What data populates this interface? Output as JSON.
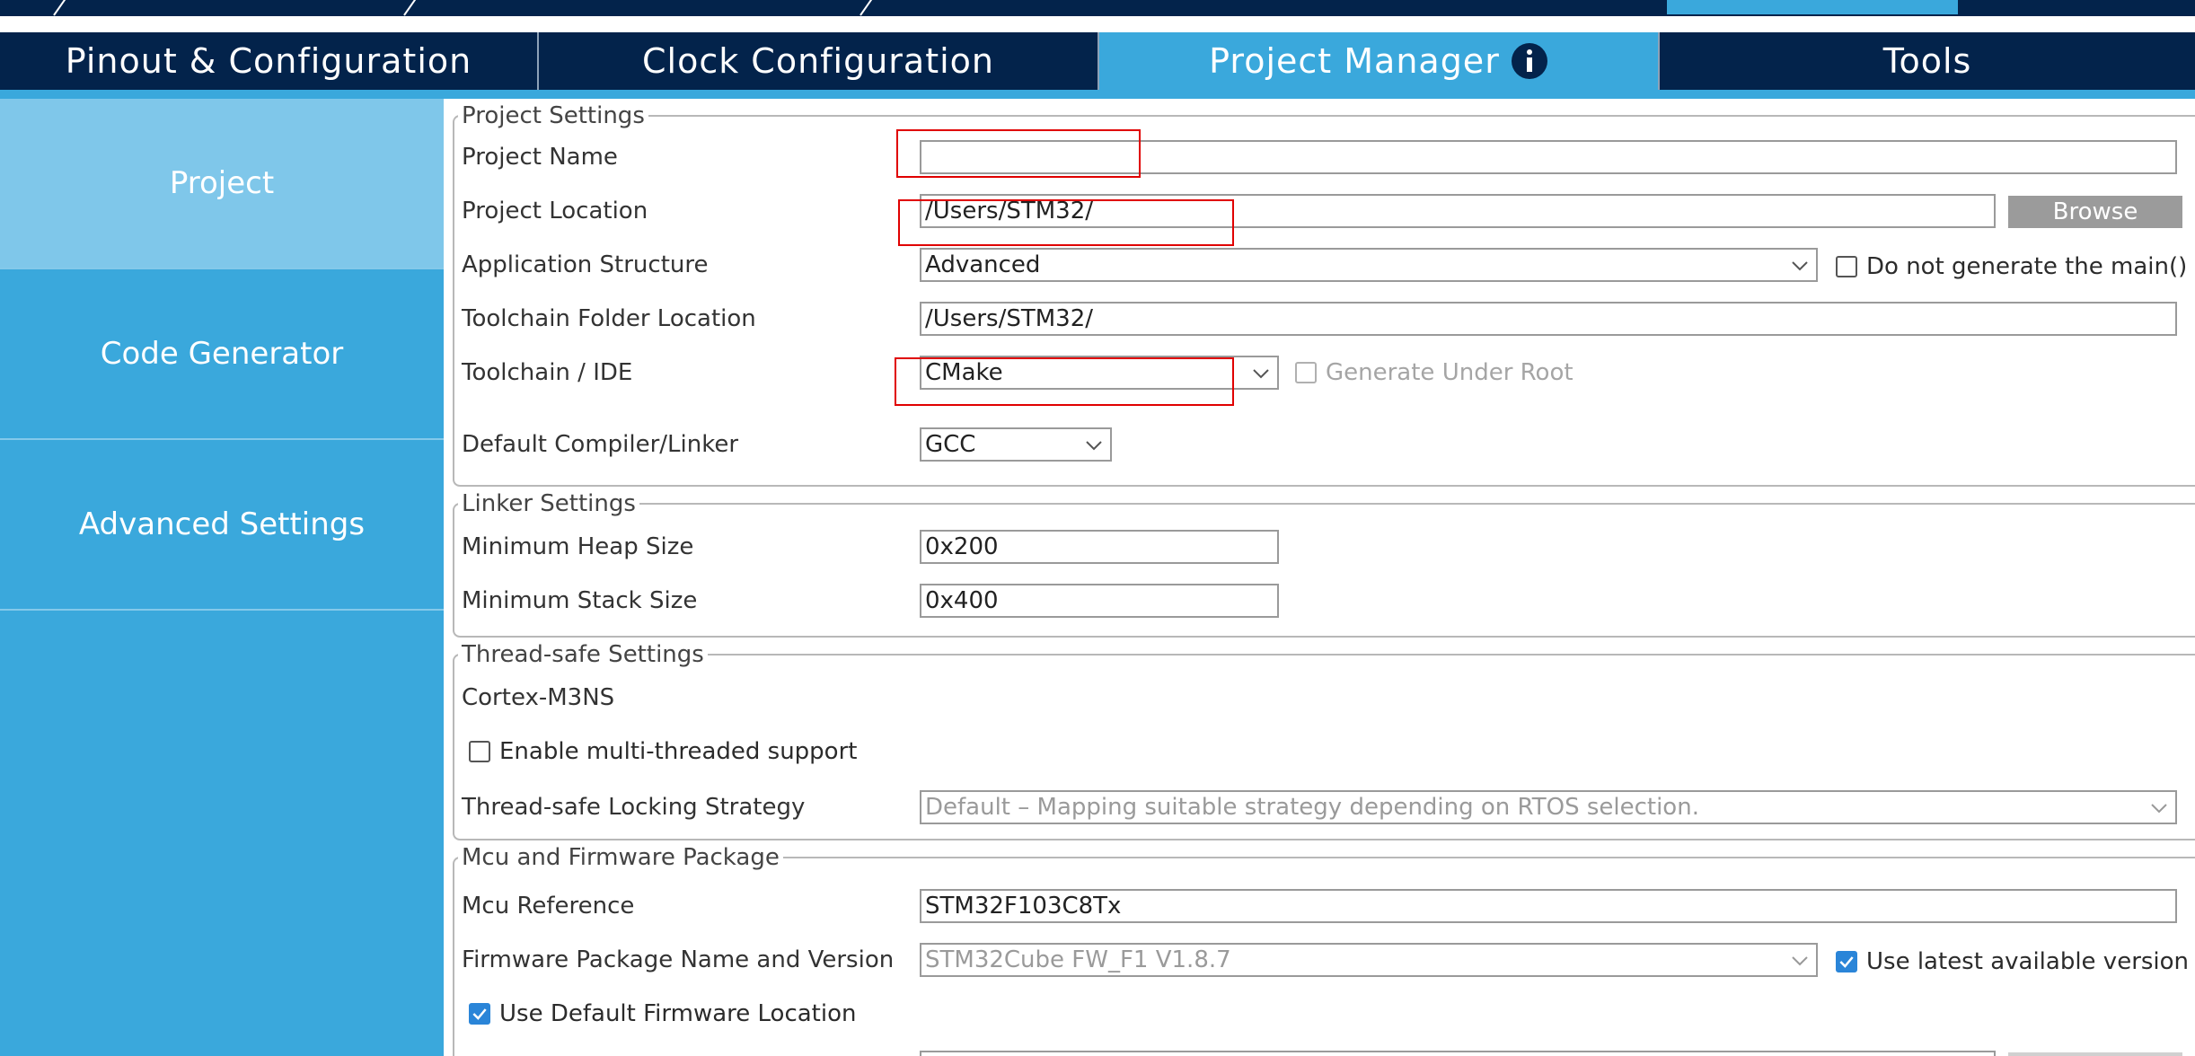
{
  "tabs": [
    {
      "label": "Pinout & Configuration"
    },
    {
      "label": "Clock Configuration"
    },
    {
      "label": "Project Manager"
    },
    {
      "label": "Tools"
    }
  ],
  "sidebar": {
    "items": [
      {
        "label": "Project"
      },
      {
        "label": "Code Generator"
      },
      {
        "label": "Advanced Settings"
      }
    ]
  },
  "project_settings": {
    "legend": "Project Settings",
    "project_name_label": "Project Name",
    "project_name_value": "",
    "project_location_label": "Project Location",
    "project_location_value": "/Users/STM32/",
    "browse_label": "Browse",
    "app_structure_label": "Application Structure",
    "app_structure_value": "Advanced",
    "no_main_label": "Do not generate the main()",
    "toolchain_folder_label": "Toolchain Folder Location",
    "toolchain_folder_value": "/Users/STM32/",
    "toolchain_ide_label": "Toolchain / IDE",
    "toolchain_ide_value": "CMake",
    "generate_under_root_label": "Generate Under Root",
    "compiler_label": "Default Compiler/Linker",
    "compiler_value": "GCC"
  },
  "linker_settings": {
    "legend": "Linker Settings",
    "heap_label": "Minimum Heap Size",
    "heap_value": "0x200",
    "stack_label": "Minimum Stack Size",
    "stack_value": "0x400"
  },
  "thread_safe_settings": {
    "legend": "Thread-safe Settings",
    "core_label": "Cortex-M3NS",
    "multithread_label": "Enable multi-threaded support",
    "locking_label": "Thread-safe Locking Strategy",
    "locking_value": "Default – Mapping suitable strategy depending on RTOS selection."
  },
  "mcu_firmware": {
    "legend": "Mcu and Firmware Package",
    "mcu_ref_label": "Mcu Reference",
    "mcu_ref_value": "STM32F103C8Tx",
    "fw_label": "Firmware Package Name and Version",
    "fw_value": "STM32Cube FW_F1 V1.8.7",
    "use_latest_label": "Use latest available version",
    "use_default_fw_label": "Use Default Firmware Location"
  },
  "colors": {
    "navy": "#03234b",
    "accent": "#3aa8dc",
    "sidebar_active": "#7fc7ea",
    "highlight": "#e00000"
  }
}
